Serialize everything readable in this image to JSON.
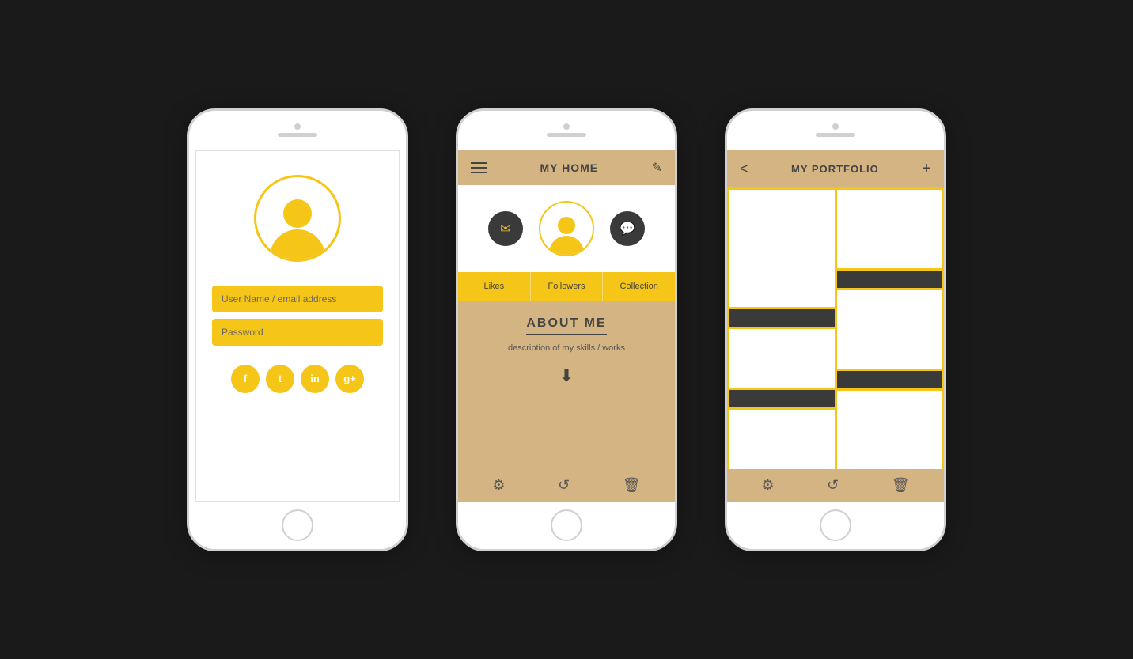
{
  "phone1": {
    "avatar_label": "user-avatar",
    "username_placeholder": "User Name / email address",
    "password_placeholder": "Password",
    "social_buttons": [
      "f",
      "t",
      "in",
      "g+"
    ]
  },
  "phone2": {
    "header": {
      "title": "MY HOME",
      "edit_icon": "✎"
    },
    "tabs": [
      "Likes",
      "Followers",
      "Collection"
    ],
    "about": {
      "title": "ABOUT ME",
      "description": "description of my skills / works"
    },
    "bottom_icons": [
      "⚙",
      "↺",
      "🗑"
    ]
  },
  "phone3": {
    "header": {
      "title": "MY PORTFOLIO",
      "back": "<",
      "add": "+"
    },
    "bottom_icons": [
      "⚙",
      "↺",
      "🗑"
    ]
  }
}
